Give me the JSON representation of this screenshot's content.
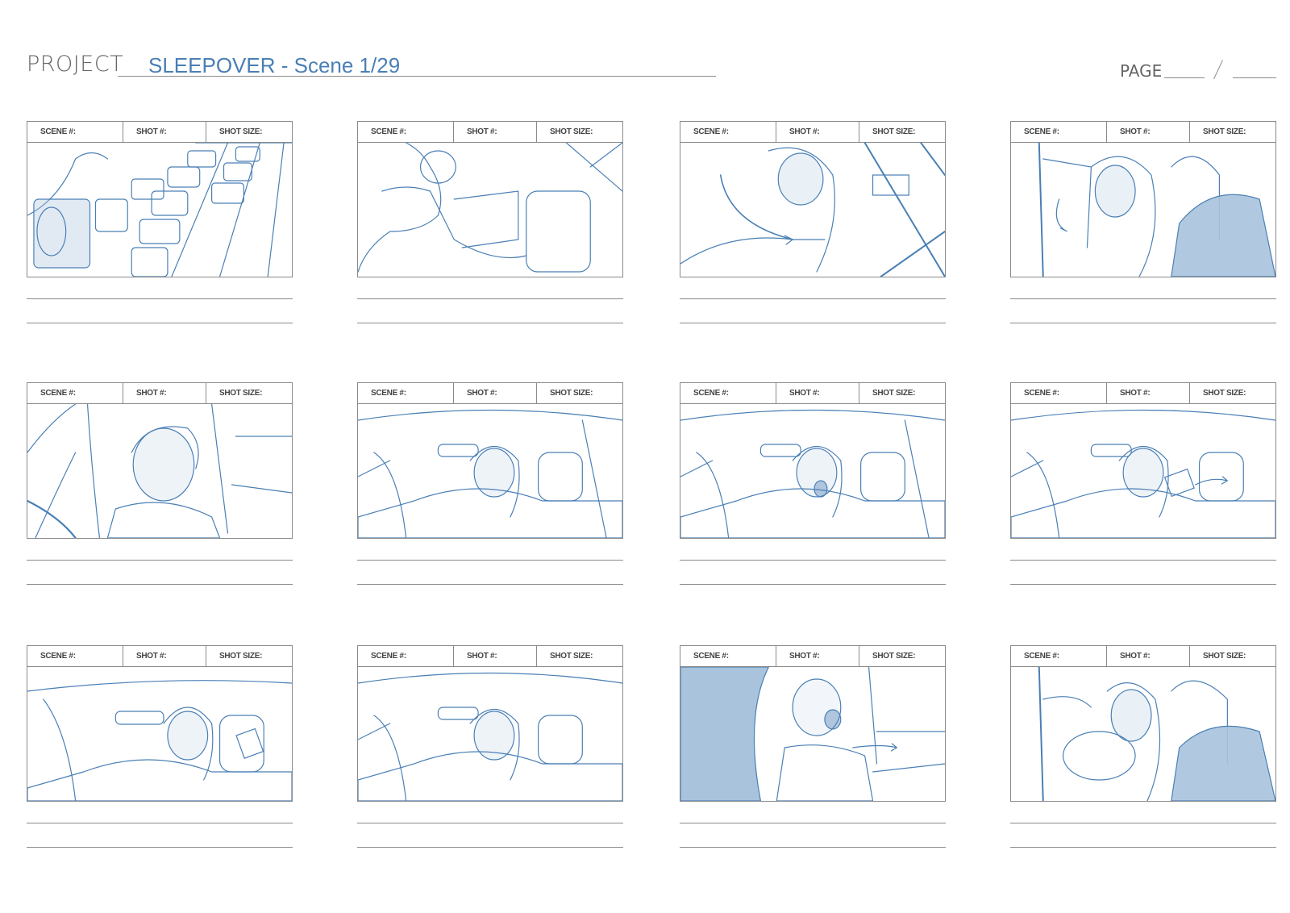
{
  "header": {
    "project_label": "PROJECT",
    "title": "SLEEPOVER - Scene 1/29",
    "page_label": "PAGE"
  },
  "frame_labels": {
    "scene": "SCENE #:",
    "shot": "SHOT #:",
    "shot_size": "SHOT SIZE:"
  },
  "colors": {
    "sketch_blue": "#4a7fb5",
    "shade_blue": "#a9c3dd",
    "rule_grey": "#8a8a8a"
  },
  "panels": [
    {
      "sketch": "highway-traffic-icon"
    },
    {
      "sketch": "child-in-back-seat-icon"
    },
    {
      "sketch": "woman-reaching-back-icon"
    },
    {
      "sketch": "woman-shouting-over-shoulder-icon"
    },
    {
      "sketch": "child-glaring-icon"
    },
    {
      "sketch": "car-interior-driver-icon"
    },
    {
      "sketch": "car-interior-driver-shouting-icon"
    },
    {
      "sketch": "car-interior-phone-throw-icon"
    },
    {
      "sketch": "car-interior-wide-icon"
    },
    {
      "sketch": "car-interior-driver-glare-icon"
    },
    {
      "sketch": "child-yelling-icon"
    },
    {
      "sketch": "woman-driving-yelling-icon"
    }
  ]
}
